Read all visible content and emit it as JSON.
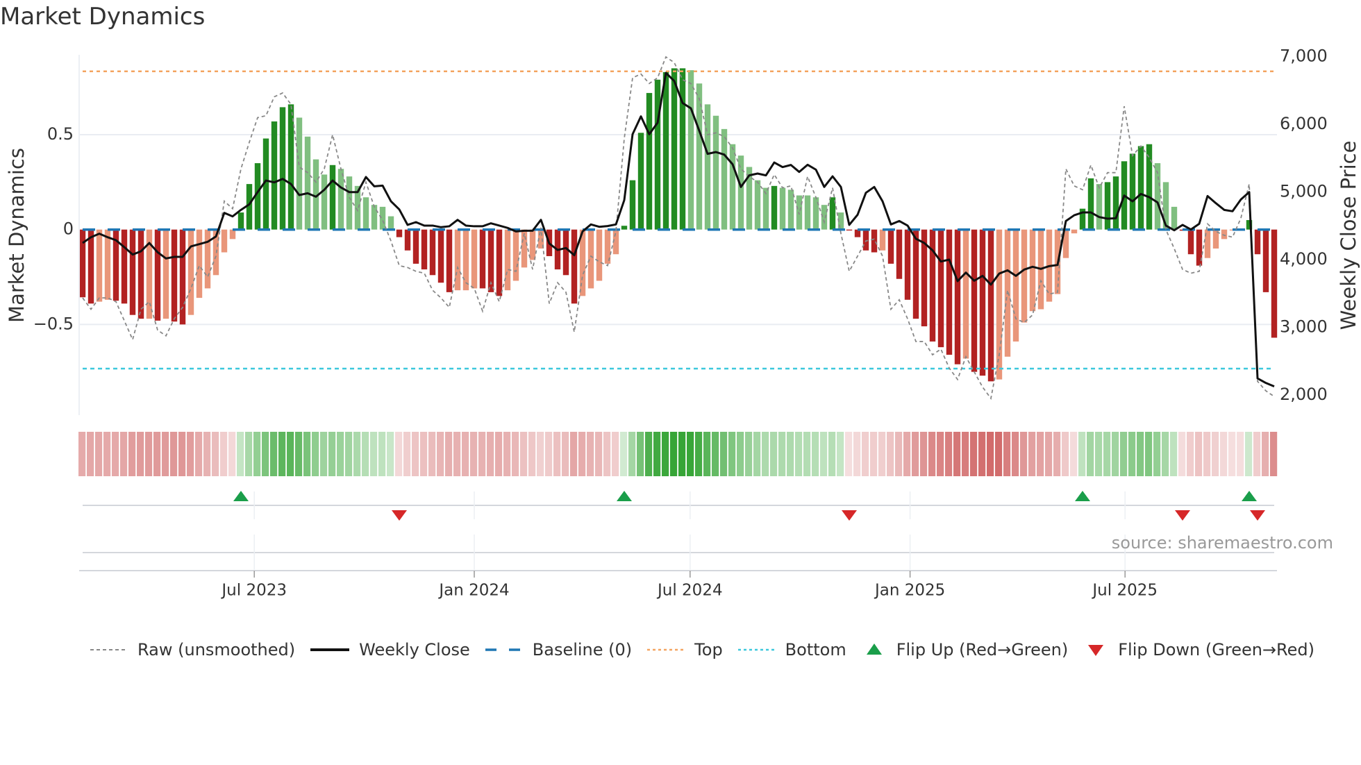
{
  "title": "Market Dynamics",
  "source": "source: sharemaestro.com",
  "colors": {
    "bar_pos_strong": "#228b22",
    "bar_pos_weak": "#80bf80",
    "bar_neg_strong": "#b22222",
    "bar_neg_weak": "#e9967a",
    "close": "#111111",
    "raw": "#888888",
    "baseline": "#1f77b4",
    "top": "#f4a460",
    "bottom": "#3cc8dc",
    "flip_up": "#1a9e4a",
    "flip_down": "#d62728",
    "heat_pos": "44,160,44",
    "heat_neg": "205,92,92"
  },
  "legend": [
    {
      "key": "raw",
      "label": "Raw (unsmoothed)"
    },
    {
      "key": "close",
      "label": "Weekly Close"
    },
    {
      "key": "baseline",
      "label": "Baseline (0)"
    },
    {
      "key": "top",
      "label": "Top"
    },
    {
      "key": "bottom",
      "label": "Bottom"
    },
    {
      "key": "flip_up",
      "label": "Flip Up (Red→Green)"
    },
    {
      "key": "flip_down",
      "label": "Flip Down (Green→Red)"
    }
  ],
  "chart_data": {
    "type": "bar",
    "title": "Market Dynamics",
    "ylabel": "Market Dynamics",
    "y2label": "Weekly Close Price",
    "ylim": [
      -0.96,
      0.96
    ],
    "y2lim": [
      2000,
      7000
    ],
    "yticks": [
      {
        "v": 0.5,
        "label": "0.5"
      },
      {
        "v": 0,
        "label": "0"
      },
      {
        "v": -0.5,
        "label": "−0.5"
      }
    ],
    "y2ticks": [
      {
        "v": 7000,
        "label": "7,000"
      },
      {
        "v": 6000,
        "label": "6,000"
      },
      {
        "v": 5000,
        "label": "5,000"
      },
      {
        "v": 4000,
        "label": "4,000"
      },
      {
        "v": 3000,
        "label": "3,000"
      },
      {
        "v": 2000,
        "label": "2,000"
      }
    ],
    "x_unit": "week index",
    "xticks": [
      {
        "week": 20.6,
        "label": "Jul 2023"
      },
      {
        "week": 47,
        "label": "Jan 2024"
      },
      {
        "week": 72.9,
        "label": "Jul 2024"
      },
      {
        "week": 99.3,
        "label": "Jan 2025"
      },
      {
        "week": 125.1,
        "label": "Jul 2025"
      }
    ],
    "top_level": 0.834,
    "bottom_level": -0.733,
    "baseline": 0,
    "momentum": [
      -0.357,
      -0.39,
      -0.38,
      -0.37,
      -0.375,
      -0.39,
      -0.45,
      -0.47,
      -0.47,
      -0.48,
      -0.47,
      -0.485,
      -0.5,
      -0.45,
      -0.36,
      -0.31,
      -0.24,
      -0.12,
      -0.05,
      0.09,
      0.24,
      0.35,
      0.48,
      0.57,
      0.645,
      0.66,
      0.59,
      0.49,
      0.37,
      0.29,
      0.34,
      0.32,
      0.28,
      0.23,
      0.17,
      0.13,
      0.12,
      0.07,
      -0.04,
      -0.11,
      -0.18,
      -0.21,
      -0.24,
      -0.28,
      -0.33,
      -0.32,
      -0.32,
      -0.31,
      -0.31,
      -0.33,
      -0.35,
      -0.32,
      -0.27,
      -0.2,
      -0.16,
      -0.1,
      -0.14,
      -0.21,
      -0.24,
      -0.39,
      -0.35,
      -0.31,
      -0.27,
      -0.18,
      -0.13,
      0.02,
      0.26,
      0.51,
      0.72,
      0.79,
      0.83,
      0.85,
      0.85,
      0.84,
      0.77,
      0.66,
      0.6,
      0.53,
      0.45,
      0.39,
      0.33,
      0.26,
      0.22,
      0.23,
      0.22,
      0.21,
      0.18,
      0.18,
      0.17,
      0.13,
      0.17,
      0.09,
      -0.005,
      -0.04,
      -0.11,
      -0.12,
      -0.11,
      -0.18,
      -0.26,
      -0.37,
      -0.47,
      -0.51,
      -0.59,
      -0.62,
      -0.66,
      -0.71,
      -0.68,
      -0.75,
      -0.77,
      -0.8,
      -0.79,
      -0.67,
      -0.59,
      -0.49,
      -0.43,
      -0.42,
      -0.38,
      -0.34,
      -0.15,
      -0.02,
      0.11,
      0.27,
      0.24,
      0.25,
      0.28,
      0.36,
      0.4,
      0.44,
      0.45,
      0.35,
      0.25,
      0.12,
      -0.006,
      -0.13,
      -0.19,
      -0.15,
      -0.1,
      -0.05,
      -0.005,
      -0.005,
      0.05,
      -0.13,
      -0.33,
      -0.57
    ],
    "strengthening": [
      1,
      1,
      0,
      0,
      1,
      1,
      1,
      1,
      0,
      1,
      0,
      1,
      1,
      0,
      0,
      0,
      0,
      0,
      0,
      1,
      1,
      1,
      1,
      1,
      1,
      1,
      0,
      0,
      0,
      0,
      1,
      0,
      0,
      0,
      0,
      0,
      0,
      0,
      1,
      1,
      1,
      1,
      1,
      1,
      1,
      0,
      0,
      0,
      1,
      1,
      1,
      0,
      0,
      0,
      0,
      0,
      1,
      1,
      1,
      1,
      0,
      0,
      0,
      0,
      0,
      1,
      1,
      1,
      1,
      1,
      1,
      1,
      1,
      0,
      0,
      0,
      0,
      0,
      0,
      0,
      0,
      0,
      0,
      1,
      0,
      0,
      0,
      0,
      0,
      0,
      1,
      0,
      1,
      1,
      1,
      1,
      0,
      1,
      1,
      1,
      1,
      1,
      1,
      1,
      1,
      1,
      0,
      1,
      1,
      1,
      0,
      0,
      0,
      0,
      0,
      0,
      0,
      0,
      0,
      0,
      1,
      1,
      0,
      1,
      1,
      1,
      1,
      1,
      1,
      0,
      0,
      0,
      1,
      1,
      1,
      0,
      0,
      0,
      0,
      0,
      1,
      1,
      1,
      1
    ],
    "raw": [
      -0.36,
      -0.42,
      -0.36,
      -0.36,
      -0.38,
      -0.48,
      -0.58,
      -0.42,
      -0.38,
      -0.53,
      -0.56,
      -0.47,
      -0.41,
      -0.31,
      -0.19,
      -0.25,
      -0.14,
      0.15,
      0.11,
      0.32,
      0.46,
      0.59,
      0.6,
      0.7,
      0.72,
      0.66,
      0.33,
      0.3,
      0.25,
      0.32,
      0.5,
      0.32,
      0.17,
      0.1,
      0.25,
      0.12,
      0.05,
      -0.06,
      -0.19,
      -0.2,
      -0.22,
      -0.23,
      -0.32,
      -0.36,
      -0.41,
      -0.2,
      -0.28,
      -0.31,
      -0.43,
      -0.28,
      -0.38,
      -0.21,
      -0.22,
      -0.02,
      -0.21,
      0.01,
      -0.39,
      -0.28,
      -0.33,
      -0.54,
      -0.24,
      -0.14,
      -0.17,
      -0.19,
      -0.01,
      0.48,
      0.8,
      0.82,
      0.77,
      0.8,
      0.91,
      0.88,
      0.79,
      0.77,
      0.69,
      0.5,
      0.51,
      0.49,
      0.43,
      0.32,
      0.28,
      0.25,
      0.19,
      0.29,
      0.22,
      0.23,
      0.08,
      0.28,
      0.17,
      0.04,
      0.22,
      -0.02,
      -0.22,
      -0.14,
      -0.06,
      -0.05,
      -0.14,
      -0.42,
      -0.37,
      -0.47,
      -0.59,
      -0.59,
      -0.66,
      -0.63,
      -0.73,
      -0.79,
      -0.67,
      -0.75,
      -0.83,
      -0.89,
      -0.66,
      -0.32,
      -0.47,
      -0.49,
      -0.45,
      -0.27,
      -0.34,
      -0.33,
      0.32,
      0.23,
      0.21,
      0.34,
      0.22,
      0.3,
      0.3,
      0.65,
      0.39,
      0.44,
      0.38,
      0.3,
      0.0,
      -0.1,
      -0.21,
      -0.23,
      -0.22,
      0.03,
      -0.01,
      -0.03,
      -0.04,
      0.06,
      0.24,
      -0.8,
      -0.85,
      -0.88
    ],
    "weekly_close": [
      4247,
      4332,
      4384,
      4332,
      4288,
      4185,
      4076,
      4124,
      4247,
      4110,
      4018,
      4042,
      4042,
      4196,
      4230,
      4264,
      4343,
      4692,
      4640,
      4736,
      4818,
      4999,
      5170,
      5143,
      5194,
      5119,
      4955,
      4982,
      4931,
      5033,
      5170,
      5067,
      4999,
      4999,
      5222,
      5085,
      5095,
      4863,
      4743,
      4514,
      4555,
      4504,
      4504,
      4480,
      4494,
      4589,
      4504,
      4494,
      4494,
      4538,
      4504,
      4470,
      4418,
      4428,
      4428,
      4589,
      4240,
      4144,
      4172,
      4066,
      4418,
      4521,
      4486,
      4497,
      4521,
      4880,
      5854,
      6118,
      5854,
      6025,
      6761,
      6641,
      6316,
      6237,
      5906,
      5564,
      5591,
      5553,
      5410,
      5075,
      5246,
      5273,
      5246,
      5437,
      5369,
      5400,
      5297,
      5403,
      5331,
      5075,
      5232,
      5075,
      4514,
      4664,
      4989,
      5075,
      4863,
      4521,
      4572,
      4504,
      4309,
      4247,
      4138,
      3973,
      4001,
      3683,
      3809,
      3689,
      3761,
      3631,
      3795,
      3843,
      3761,
      3854,
      3895,
      3864,
      3905,
      3922,
      4572,
      4657,
      4698,
      4698,
      4630,
      4606,
      4613,
      4948,
      4863,
      4972,
      4924,
      4846,
      4504,
      4435,
      4514,
      4446,
      4531,
      4941,
      4835,
      4736,
      4716,
      4890,
      4999,
      2246,
      2178,
      2127
    ],
    "flips_up": [
      19,
      65,
      120,
      140
    ],
    "flips_down": [
      38,
      92,
      132,
      141
    ],
    "legend_position": "bottom"
  }
}
